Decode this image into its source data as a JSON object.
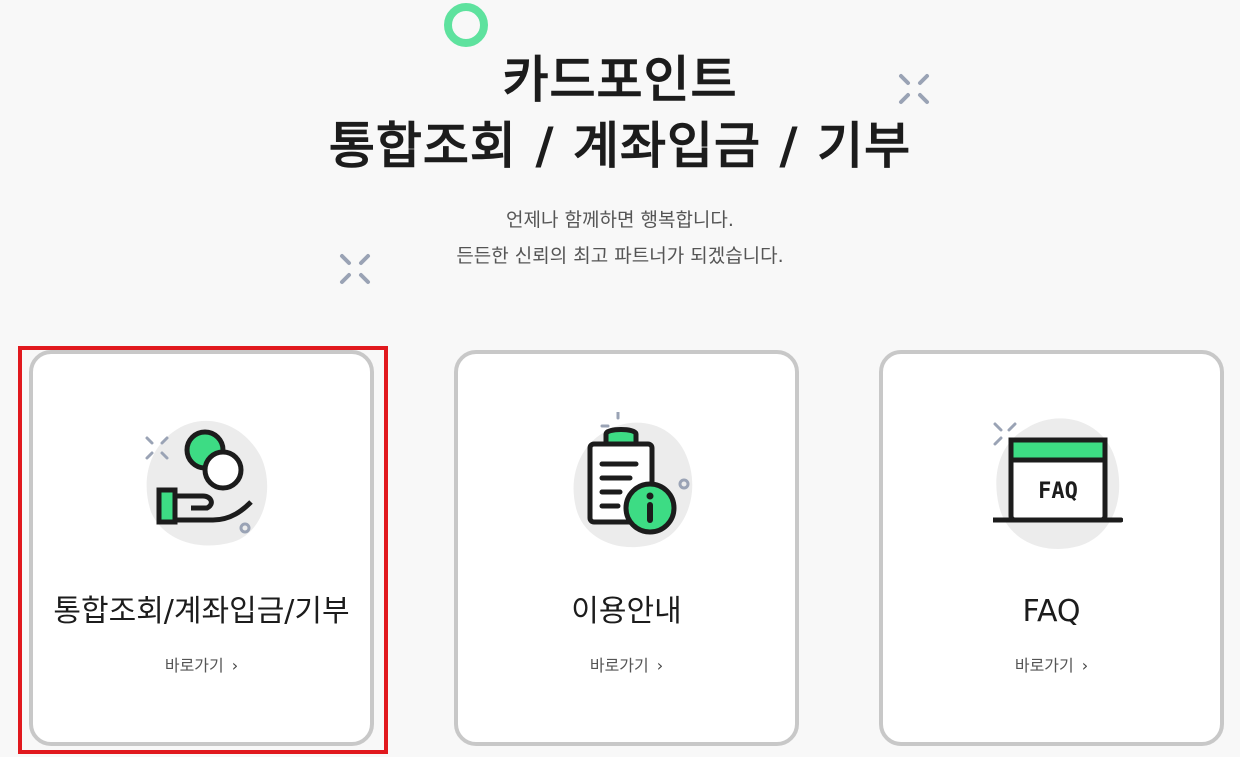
{
  "hero": {
    "title_line1": "카드포인트",
    "title_line2": "통합조회 / 계좌입금 / 기부",
    "subtitle_line1": "언제나 함께하면 행복합니다.",
    "subtitle_line2": "든든한 신뢰의 최고 파트너가 되겠습니다."
  },
  "cards": [
    {
      "title": "통합조회/계좌입금/기부",
      "link_label": "바로가기",
      "icon": "coin-hand-icon",
      "selected": true
    },
    {
      "title": "이용안내",
      "link_label": "바로가기",
      "icon": "clipboard-info-icon",
      "selected": false
    },
    {
      "title": "FAQ",
      "link_label": "바로가기",
      "icon": "faq-window-icon",
      "selected": false
    }
  ],
  "faq_icon_text": "FAQ",
  "colors": {
    "accent_green": "#3ddc84",
    "ring_green": "#5ee29e",
    "highlight_red": "#e1191e",
    "card_border": "#c8c8c8",
    "background": "#f8f8f8"
  }
}
